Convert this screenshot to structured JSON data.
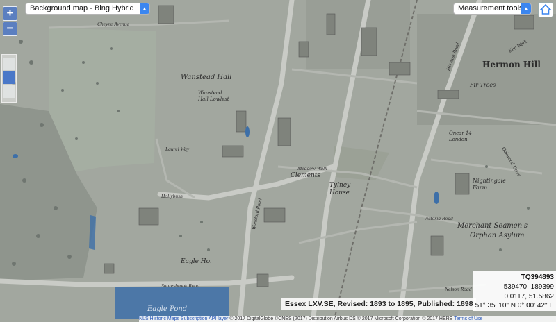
{
  "controls": {
    "background_map": "Background map - Bing Hybrid",
    "measurement_tools": "Measurement tools",
    "zoom_in": "+",
    "zoom_out": "−"
  },
  "map_labels": {
    "hermon_hill": "Hermon Hill",
    "wanstead_hall": "Wanstead Hall",
    "wanstead_hall_sub": "Wanstead Hall Lowlest",
    "eagle_pond": "Eagle Pond",
    "eagle_ho": "Eagle Ho.",
    "clements": "Clements",
    "tylney_house": "Tylney House",
    "nightingale_farm": "Nightingale Farm",
    "merchant_seamens": "Merchant Seamen's",
    "orphan_asylum": "Orphan Asylum",
    "fir_trees": "Fir Trees",
    "oncar": "Oncar 14 London"
  },
  "streets": {
    "cheyne": "Cheyne Avenue",
    "laurel": "Laurel Way",
    "meadow": "Meadow Walk",
    "wansford": "Wansford Road",
    "snaresbrook": "Snaresbrook Road",
    "hollybush": "Hollybush",
    "victoria": "Victoria Road",
    "nelson": "Nelson Road",
    "oakwood": "Oakwood Drive",
    "hermon_rd": "Hermon Road",
    "elm_walk": "Elm Walk"
  },
  "footer": {
    "sheet_title": "Essex LXV.SE, Revised: 1893 to 1895, Published: 1898",
    "grid_ref": "TQ394893",
    "easting_northing": "539470, 189399",
    "lonlat": "0.0117, 51.5862",
    "dms": "51° 35' 10\" N 0° 00' 42\" E",
    "attribution_link": "NLS Historic Maps Subscription API layer",
    "attribution": "© 2017 DigitalGlobe ©CNES (2017) Distribution Airbus DS © 2017 Microsoft Corporation © 2017 HERE",
    "terms": "Terms of Use"
  },
  "colors": {
    "accent": "#3b86f0",
    "zoom": "#5b7fc0",
    "pond": "#3d6fa8"
  }
}
